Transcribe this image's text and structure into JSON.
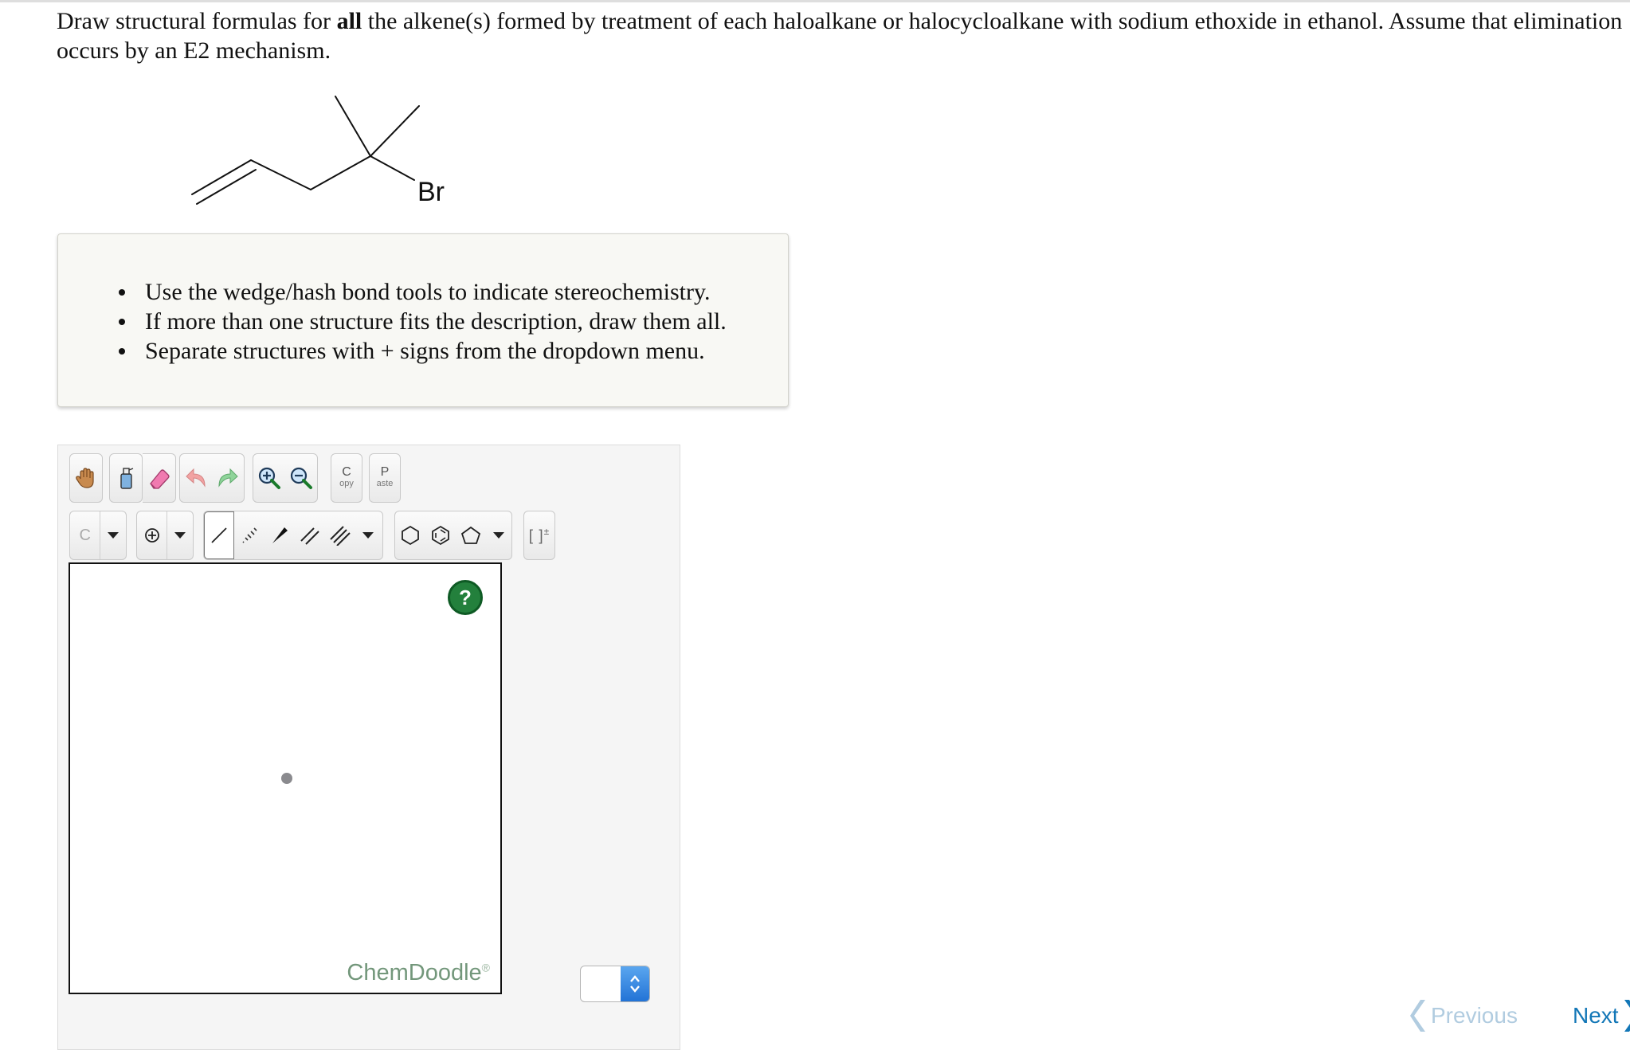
{
  "question": {
    "part1": "Draw structural formulas for ",
    "bold": "all",
    "part2": " the alkene(s) formed by treatment of each haloalkane or halocycloalkane with sodium ethoxide in ethanol. Assume that elimination occurs by an E2 mechanism."
  },
  "molecule": {
    "halogen_label": "Br"
  },
  "instructions": [
    "Use the wedge/hash bond tools to indicate stereochemistry.",
    "If more than one structure fits the description, draw them all.",
    "Separate structures with + signs from the dropdown menu."
  ],
  "toolbar": {
    "copy_big": "C",
    "copy_small": "opy",
    "paste_big": "P",
    "paste_small": "aste",
    "element_label": "C",
    "bracket_label": "[ ]",
    "bracket_sup": "±"
  },
  "canvas": {
    "help_label": "?",
    "brand": "ChemDoodle",
    "brand_mark": "®"
  },
  "nav": {
    "previous": "Previous",
    "next": "Next"
  },
  "colors": {
    "nav_link": "#1377b7",
    "nav_disabled": "#b1cce0",
    "help_green": "#23803c",
    "brand": "#73977b"
  }
}
